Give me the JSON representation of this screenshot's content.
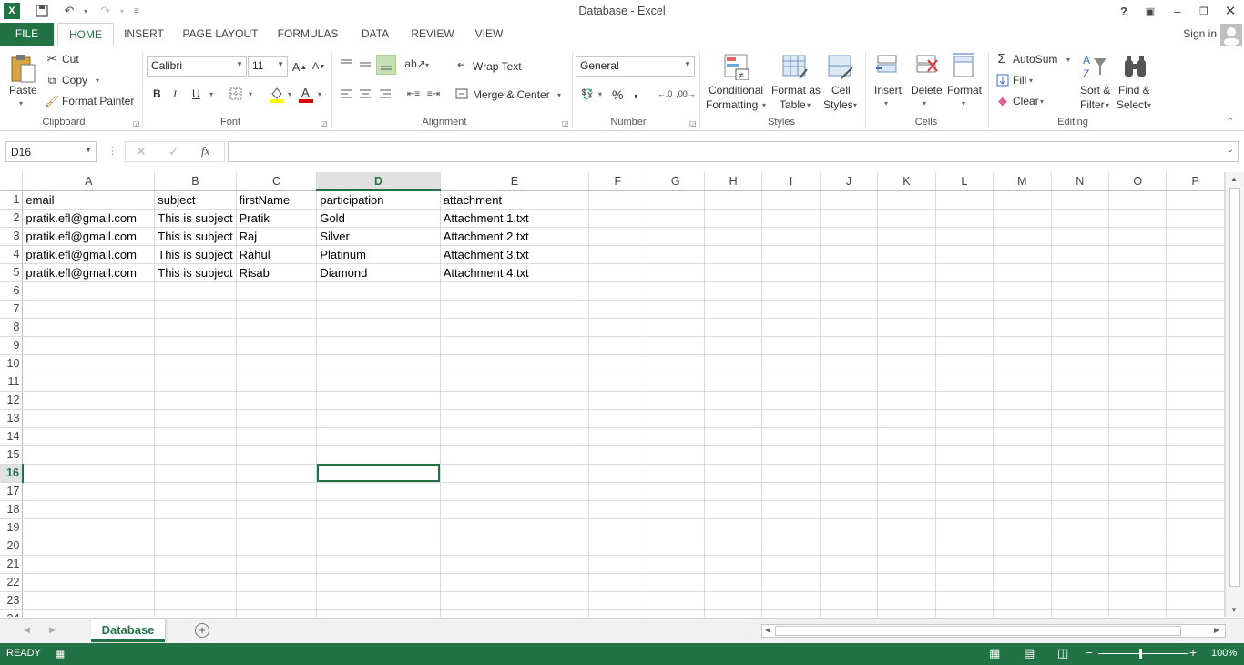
{
  "window": {
    "title": "Database - Excel",
    "help": "?",
    "signin": "Sign in"
  },
  "tabs": [
    "FILE",
    "HOME",
    "INSERT",
    "PAGE LAYOUT",
    "FORMULAS",
    "DATA",
    "REVIEW",
    "VIEW"
  ],
  "ribbon": {
    "clipboard": {
      "label": "Clipboard",
      "paste": "Paste",
      "cut": "Cut",
      "copy": "Copy",
      "format_painter": "Format Painter"
    },
    "font": {
      "label": "Font",
      "name": "Calibri",
      "size": "11",
      "bold": "B",
      "italic": "I",
      "underline": "U"
    },
    "alignment": {
      "label": "Alignment",
      "wrap_text": "Wrap Text",
      "merge_center": "Merge & Center"
    },
    "number": {
      "label": "Number",
      "format": "General",
      "percent": "%",
      "comma": ","
    },
    "styles": {
      "label": "Styles",
      "conditional_1": "Conditional",
      "conditional_2": "Formatting",
      "format_table_1": "Format as",
      "format_table_2": "Table",
      "cell_styles_1": "Cell",
      "cell_styles_2": "Styles"
    },
    "cells": {
      "label": "Cells",
      "insert": "Insert",
      "delete": "Delete",
      "format": "Format"
    },
    "editing": {
      "label": "Editing",
      "autosum": "AutoSum",
      "fill": "Fill",
      "clear": "Clear",
      "sort_1": "Sort &",
      "sort_2": "Filter",
      "find_1": "Find &",
      "find_2": "Select"
    }
  },
  "formula_bar": {
    "name_box": "D16",
    "fx": "fx",
    "value": ""
  },
  "columns": [
    "A",
    "B",
    "C",
    "D",
    "E",
    "F",
    "G",
    "H",
    "I",
    "J",
    "K",
    "L",
    "M",
    "N",
    "O",
    "P"
  ],
  "rows": [
    [
      "email",
      "subject",
      "firstName",
      "participation",
      "attachment"
    ],
    [
      "pratik.efl@gmail.com",
      "This is subject",
      "Pratik",
      "Gold",
      "Attachment 1.txt"
    ],
    [
      "pratik.efl@gmail.com",
      "This is subject",
      "Raj",
      "Silver",
      "Attachment 2.txt"
    ],
    [
      "pratik.efl@gmail.com",
      "This is subject",
      "Rahul",
      "Platinum",
      "Attachment 3.txt"
    ],
    [
      "pratik.efl@gmail.com",
      "This is subject",
      "Risab",
      "Diamond",
      "Attachment 4.txt"
    ]
  ],
  "row_count": 24,
  "selected_cell": "D16",
  "sheet_tab": "Database",
  "status": {
    "state": "READY",
    "zoom": "100%"
  },
  "colors": {
    "accent": "#217346"
  }
}
